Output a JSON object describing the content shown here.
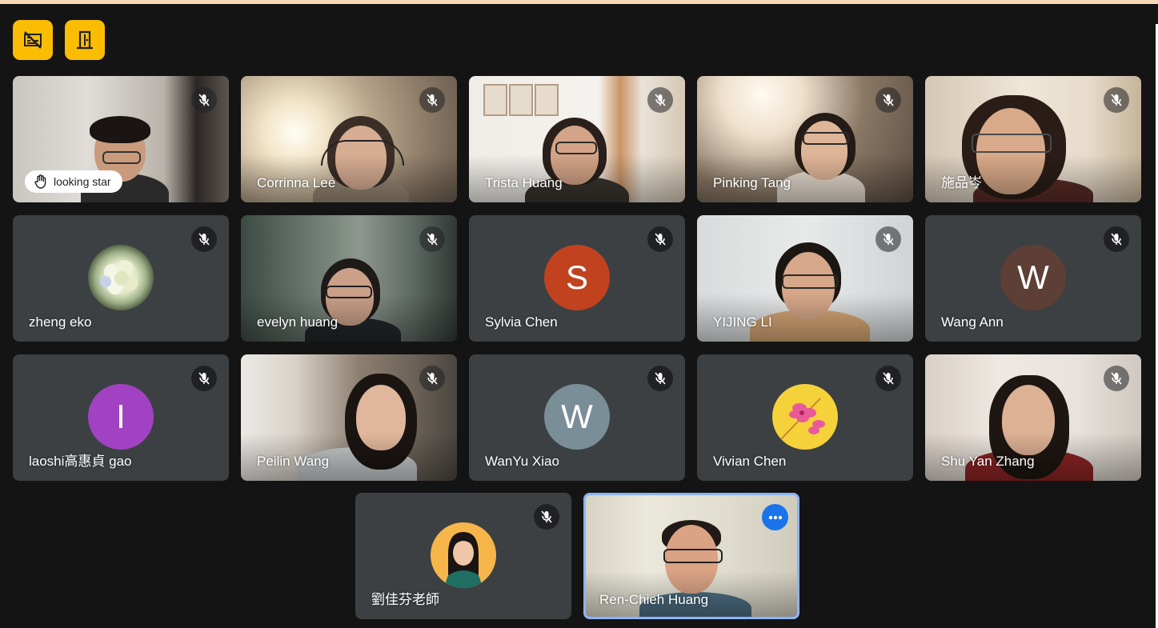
{
  "toolbar": {
    "buttons": [
      {
        "icon": "video-grid-off-icon",
        "color": "#fbbc04"
      },
      {
        "icon": "exit-door-icon",
        "color": "#fbbc04"
      }
    ]
  },
  "participants": [
    {
      "name": "",
      "raised_hand_label": "looking star",
      "muted": true,
      "video": true
    },
    {
      "name": "Corrinna Lee",
      "muted": true,
      "video": true
    },
    {
      "name": "Trista Huang",
      "muted": true,
      "video": true
    },
    {
      "name": "Pinking Tang",
      "muted": true,
      "video": true
    },
    {
      "name": "施品岑",
      "muted": true,
      "video": true
    },
    {
      "name": "zheng eko",
      "muted": true,
      "video": false,
      "avatar": "hydrangea-photo"
    },
    {
      "name": "evelyn huang",
      "muted": true,
      "video": true
    },
    {
      "name": "Sylvia Chen",
      "muted": true,
      "video": false,
      "initial": "S",
      "avatar_color": "#c1421f"
    },
    {
      "name": "YIJING LI",
      "muted": true,
      "video": true
    },
    {
      "name": "Wang Ann",
      "muted": true,
      "video": false,
      "initial": "W",
      "avatar_color": "#5d3f36"
    },
    {
      "name": "laoshi高惠貞 gao",
      "muted": true,
      "video": false,
      "initial": "I",
      "avatar_color": "#a142c2"
    },
    {
      "name": "Peilin Wang",
      "muted": true,
      "video": true
    },
    {
      "name": "WanYu Xiao",
      "muted": true,
      "video": false,
      "initial": "W",
      "avatar_color": "#7a8e98"
    },
    {
      "name": "Vivian Chen",
      "muted": true,
      "video": false,
      "avatar": "flower-illustration"
    },
    {
      "name": "Shu Yan Zhang",
      "muted": true,
      "video": true
    },
    {
      "name": "劉佳芬老師",
      "muted": true,
      "video": false,
      "avatar": "portrait-photo"
    },
    {
      "name": "Ren-Chieh Huang",
      "muted": false,
      "video": true,
      "self": true
    }
  ]
}
